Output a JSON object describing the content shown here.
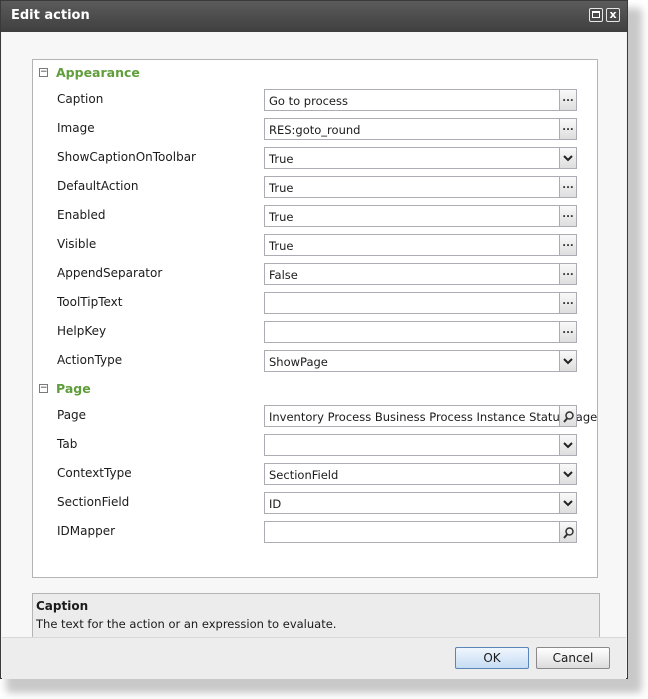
{
  "window": {
    "title": "Edit action",
    "close_glyph": "x"
  },
  "sections": [
    {
      "label": "Appearance",
      "expander": "−",
      "rows": [
        {
          "label": "Caption",
          "value": "Go to process",
          "editor": "ellipsis"
        },
        {
          "label": "Image",
          "value": "RES:goto_round",
          "editor": "ellipsis"
        },
        {
          "label": "ShowCaptionOnToolbar",
          "value": "True",
          "editor": "dropdown"
        },
        {
          "label": "DefaultAction",
          "value": "True",
          "editor": "ellipsis"
        },
        {
          "label": "Enabled",
          "value": "True",
          "editor": "ellipsis"
        },
        {
          "label": "Visible",
          "value": "True",
          "editor": "ellipsis"
        },
        {
          "label": "AppendSeparator",
          "value": "False",
          "editor": "ellipsis"
        },
        {
          "label": "ToolTipText",
          "value": "",
          "editor": "ellipsis"
        },
        {
          "label": "HelpKey",
          "value": "",
          "editor": "ellipsis"
        },
        {
          "label": "ActionType",
          "value": "ShowPage",
          "editor": "dropdown"
        }
      ]
    },
    {
      "label": "Page",
      "expander": "−",
      "rows": [
        {
          "label": "Page",
          "value": "Inventory Process Business Process Instance Status Page",
          "editor": "search"
        },
        {
          "label": "Tab",
          "value": "",
          "editor": "dropdown"
        },
        {
          "label": "ContextType",
          "value": "SectionField",
          "editor": "dropdown"
        },
        {
          "label": "SectionField",
          "value": "ID",
          "editor": "dropdown"
        },
        {
          "label": "IDMapper",
          "value": "",
          "editor": "search"
        }
      ]
    }
  ],
  "ellipsis_glyph": "...",
  "help": {
    "title": "Caption",
    "description": "The text for the action or an expression to evaluate."
  },
  "buttons": {
    "ok": "OK",
    "cancel": "Cancel"
  }
}
